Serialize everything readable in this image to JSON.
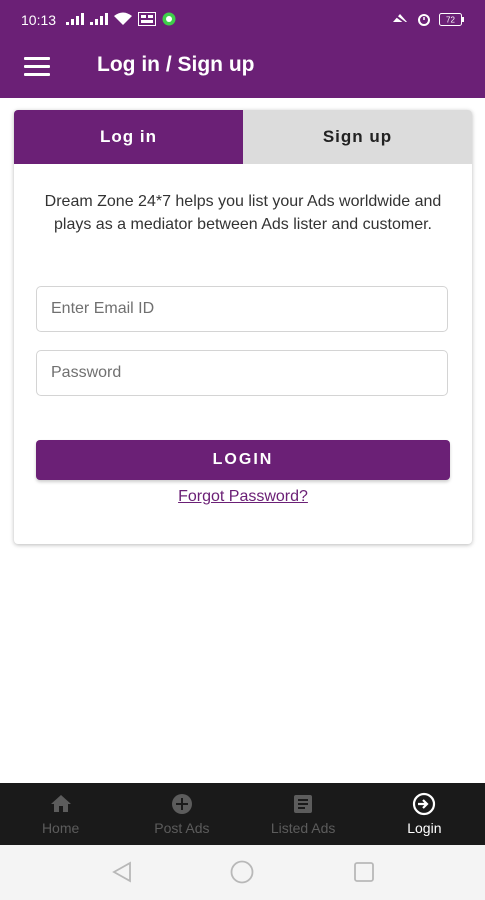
{
  "status_bar": {
    "time": "10:13",
    "battery": "72"
  },
  "app_bar": {
    "title": "Log in / Sign up"
  },
  "tabs": [
    {
      "label": "Log in",
      "active": true
    },
    {
      "label": "Sign up",
      "active": false
    }
  ],
  "intro_text": "Dream Zone 24*7 helps you list your Ads worldwide and plays as a mediator between Ads lister and customer.",
  "form": {
    "email_placeholder": "Enter Email ID",
    "password_placeholder": "Password",
    "login_label": "LOGIN",
    "forgot_label": "Forgot Password?"
  },
  "bottom_nav": [
    {
      "label": "Home",
      "icon": "home-icon",
      "active": false
    },
    {
      "label": "Post Ads",
      "icon": "add-circle-icon",
      "active": false
    },
    {
      "label": "Listed Ads",
      "icon": "list-icon",
      "active": false
    },
    {
      "label": "Login",
      "icon": "login-icon",
      "active": true
    }
  ],
  "colors": {
    "primary": "#6b2076",
    "nav_background": "#1a1a1a",
    "inactive_tab": "#dcdcdc"
  }
}
